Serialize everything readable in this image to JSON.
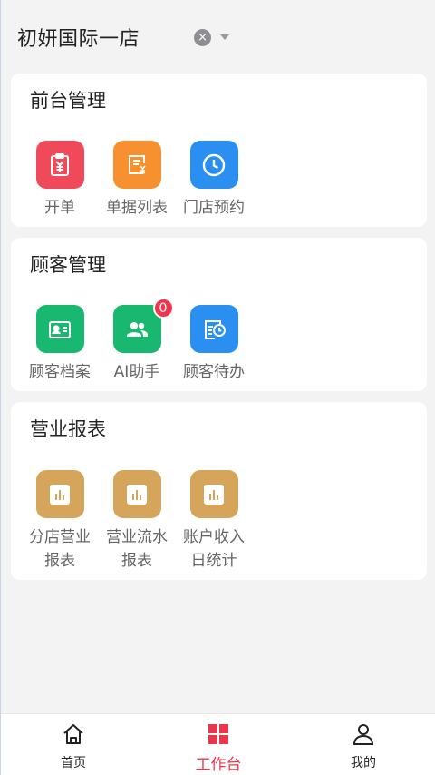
{
  "header": {
    "store_name": "初妍国际一店",
    "clear_glyph": "×"
  },
  "sections": [
    {
      "title": "前台管理",
      "items": [
        {
          "label": "开单",
          "icon": "receipt-yen-icon",
          "color": "#f04a5a"
        },
        {
          "label": "单据列表",
          "icon": "invoice-list-icon",
          "color": "#f7902e"
        },
        {
          "label": "门店预约",
          "icon": "clock-icon",
          "color": "#2a8ff0"
        }
      ]
    },
    {
      "title": "顾客管理",
      "items": [
        {
          "label": "顾客档案",
          "icon": "id-card-icon",
          "color": "#18b870"
        },
        {
          "label": "AI助手",
          "icon": "users-icon",
          "color": "#18b870",
          "badge": "0"
        },
        {
          "label": "顾客待办",
          "icon": "todo-clock-icon",
          "color": "#2a8ff0"
        }
      ]
    },
    {
      "title": "营业报表",
      "items": [
        {
          "label": "分店营业\n报表",
          "icon": "bar-chart-icon",
          "color": "#d4a55a"
        },
        {
          "label": "营业流水\n报表",
          "icon": "bar-chart-icon",
          "color": "#d4a55a"
        },
        {
          "label": "账户收入\n日统计",
          "icon": "bar-chart-icon",
          "color": "#d4a55a"
        }
      ]
    }
  ],
  "tabbar": {
    "items": [
      {
        "label": "首页",
        "icon": "home-icon"
      },
      {
        "label": "工作台",
        "icon": "grid-icon",
        "active": true
      },
      {
        "label": "我的",
        "icon": "person-icon"
      }
    ],
    "active_color": "#e8374b"
  }
}
